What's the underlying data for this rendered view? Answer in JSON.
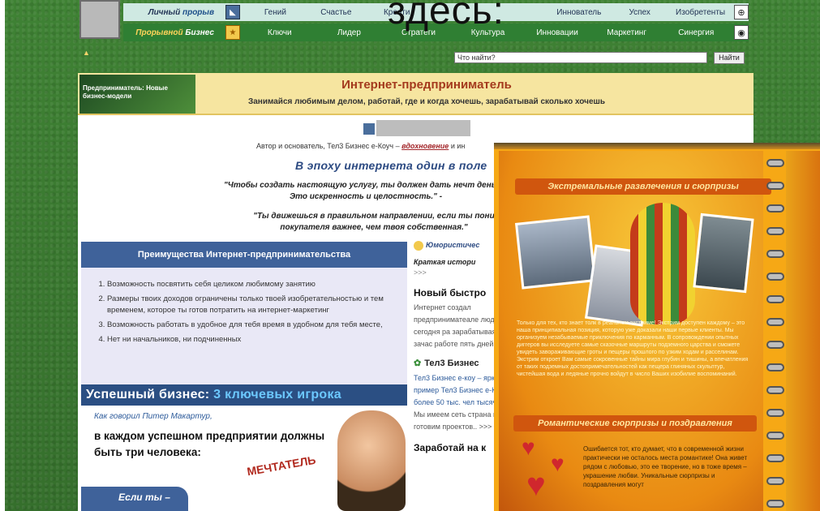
{
  "overlay_title": "здесь:",
  "nav": {
    "row1_lead_a": "Личный",
    "row1_lead_b": "прорыв",
    "row1_items": [
      "Гений",
      "Счастье",
      "Креати",
      "",
      "",
      "Иннователь",
      "Успех",
      "Изобретенты"
    ],
    "row2_lead_a": "Прорывной",
    "row2_lead_b": "Бизнес",
    "row2_items": [
      "Ключи",
      "Лидер",
      "Стратеги",
      "Культура",
      "Инновации",
      "Маркетинг",
      "Синергия"
    ]
  },
  "search": {
    "placeholder": "Что найти?",
    "button": "Найти"
  },
  "banner": {
    "left_text": "Предприниматель: Новые бизнес-модели",
    "title": "Интернет-предприниматель",
    "subtitle": "Занимайся любимым делом, работай, где и когда хочешь, зарабатывай сколько хочешь"
  },
  "author": {
    "prefix": "Автор и основатель, Тел3 Бизнес е-Коуч –",
    "link1": "вдохновение",
    "link2": "и ин"
  },
  "epoch": "В эпоху интернета один в поле",
  "quotes": [
    "\"Чтобы создать настоящую услугу, ты должен дать нечт деньги. Это искренность и целостность.\" -",
    "\"Ты движешься в правильном направлении, если ты пони покупателя важнее, чем твоя собственная.\""
  ],
  "advantages": {
    "heading": "Преимущества Интернет-предпринимательства",
    "items": [
      "Возможность посвятить себя целиком любимому занятию",
      "Размеры твоих доходов ограничены только твоей изобретательностью и тем временем, которое ты готов потратить на интернет-маркетинг",
      "Возможность работать в удобное для тебя время в удобном для тебя месте,",
      "Нет ни начальников, ни подчиненных"
    ]
  },
  "success": {
    "title": "Успешный бизнес:",
    "accent": "3 ключевых игрока"
  },
  "promo": {
    "quote_intro": "Как говорил Питер Макартур,",
    "headline": "в каждом успешном предприятии должны быть три человека:",
    "badge": "МЕЧТАТЕЛЬ",
    "blue_text": "Если ты –"
  },
  "side": {
    "humor": "Юмористичес",
    "history": "Краткая истори",
    "more": ">>>",
    "new_title": "Новый быстро",
    "new_par": "Интернет создал предприниматеале людей сегодня ра зарабатывая зачас работе пять дней",
    "ten_title": "Тел3 Бизнес",
    "ten_par": "Тел3 Бизнес е-коу – яркий пример Тел3 Бизнес е-Ко более 50 тыс. чел тысяч.",
    "ten_par2": "Мы имеем сеть страна и готовим проектов.. >>>",
    "earn": "Заработай на к"
  },
  "book": {
    "ribbon1": "Экстремальные развлечения и сюрпризы",
    "ribbon2": "Романтические сюрпризы и поздравления",
    "text1": "Только для тех, кто знает толк в реальном экстриме! Экстрим доступен каждому – это наша принципиальная позиция, которую уже доказали наши первые клиенты. Мы организуем незабываемые приключения по карманным. В сопровождении опытных диггеров вы исследуете самые сказочные маршруты подземного царства и сможете увидеть завораживающие гроты и пещеры прошлого по узким ходам и расселинам. Экстрим откроет Вам самые сокровенные тайны мира глубин и тишины, а впечатления от таких подземных достопримечательностей как пещера глиняных скульптур, чистейшая вода и ледяные прочно войдут в число Ваших изобилие воспоминаний.",
    "text2": "Ошибается тот, кто думает, что в современной жизни практически не осталось места романтике! Она живет рядом с любовью, это ее творение, но в тоже время – украшение любви. Уникальные сюрпризы и поздравления могут"
  }
}
